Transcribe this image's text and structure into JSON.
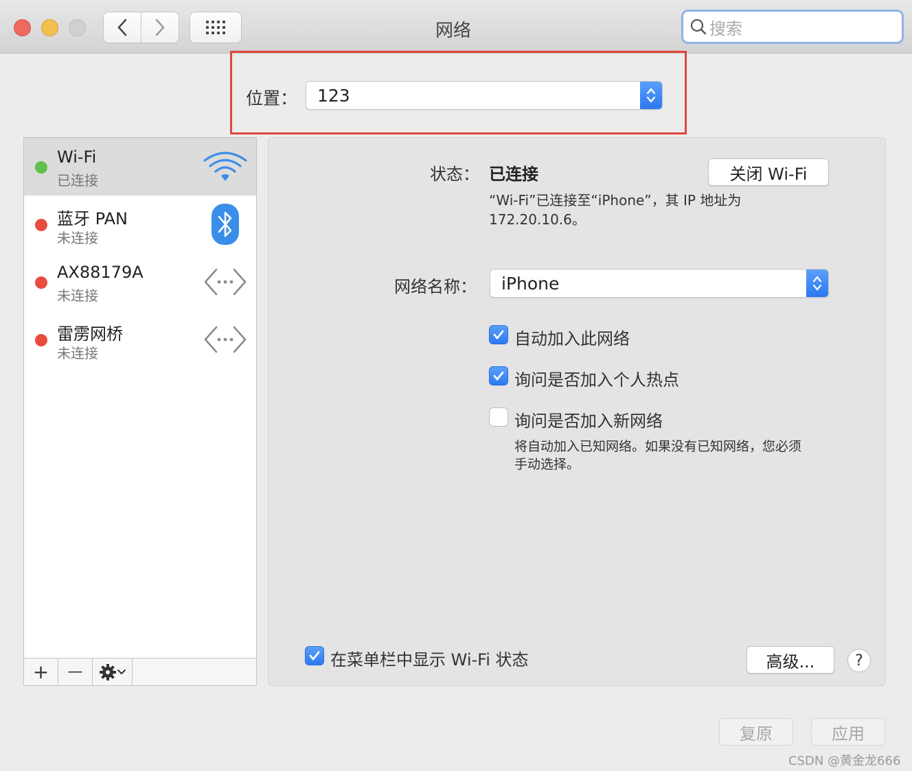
{
  "window": {
    "title": "网络"
  },
  "search": {
    "placeholder": "搜索"
  },
  "location": {
    "label": "位置：",
    "value": "123"
  },
  "services": [
    {
      "name": "Wi-Fi",
      "status": "已连接",
      "status_color": "#5ec14b",
      "icon": "wifi-icon"
    },
    {
      "name": "蓝牙 PAN",
      "status": "未连接",
      "status_color": "#ea4b3f",
      "icon": "bluetooth-icon"
    },
    {
      "name": "AX88179A",
      "status": "未连接",
      "status_color": "#ea4b3f",
      "icon": "ethernet-icon"
    },
    {
      "name": "雷雳网桥",
      "status": "未连接",
      "status_color": "#ea4b3f",
      "icon": "ethernet-icon"
    }
  ],
  "sidebar_toolbar": {
    "add": "+",
    "remove": "—"
  },
  "detail": {
    "status_label": "状态：",
    "status_value": "已连接",
    "turn_off_button": "关闭 Wi-Fi",
    "status_desc_line1": "“Wi-Fi”已连接至“iPhone”，其 IP 地址为",
    "status_desc_line2": "172.20.10.6。",
    "network_name_label": "网络名称：",
    "network_name_value": "iPhone",
    "checkboxes": [
      {
        "label": "自动加入此网络",
        "checked": true
      },
      {
        "label": "询问是否加入个人热点",
        "checked": true
      },
      {
        "label": "询问是否加入新网络",
        "checked": false
      }
    ],
    "hint_line1": "将自动加入已知网络。如果没有已知网络，您必须",
    "hint_line2": "手动选择。",
    "show_in_menubar": {
      "label": "在菜单栏中显示 Wi-Fi 状态",
      "checked": true
    },
    "advanced_button": "高级...",
    "help_button": "?"
  },
  "footer": {
    "revert_button": "复原",
    "apply_button": "应用"
  },
  "watermark": "CSDN @黄金龙666",
  "colors": {
    "accent": "#2d78f2",
    "highlight_box": "#e0463a"
  }
}
